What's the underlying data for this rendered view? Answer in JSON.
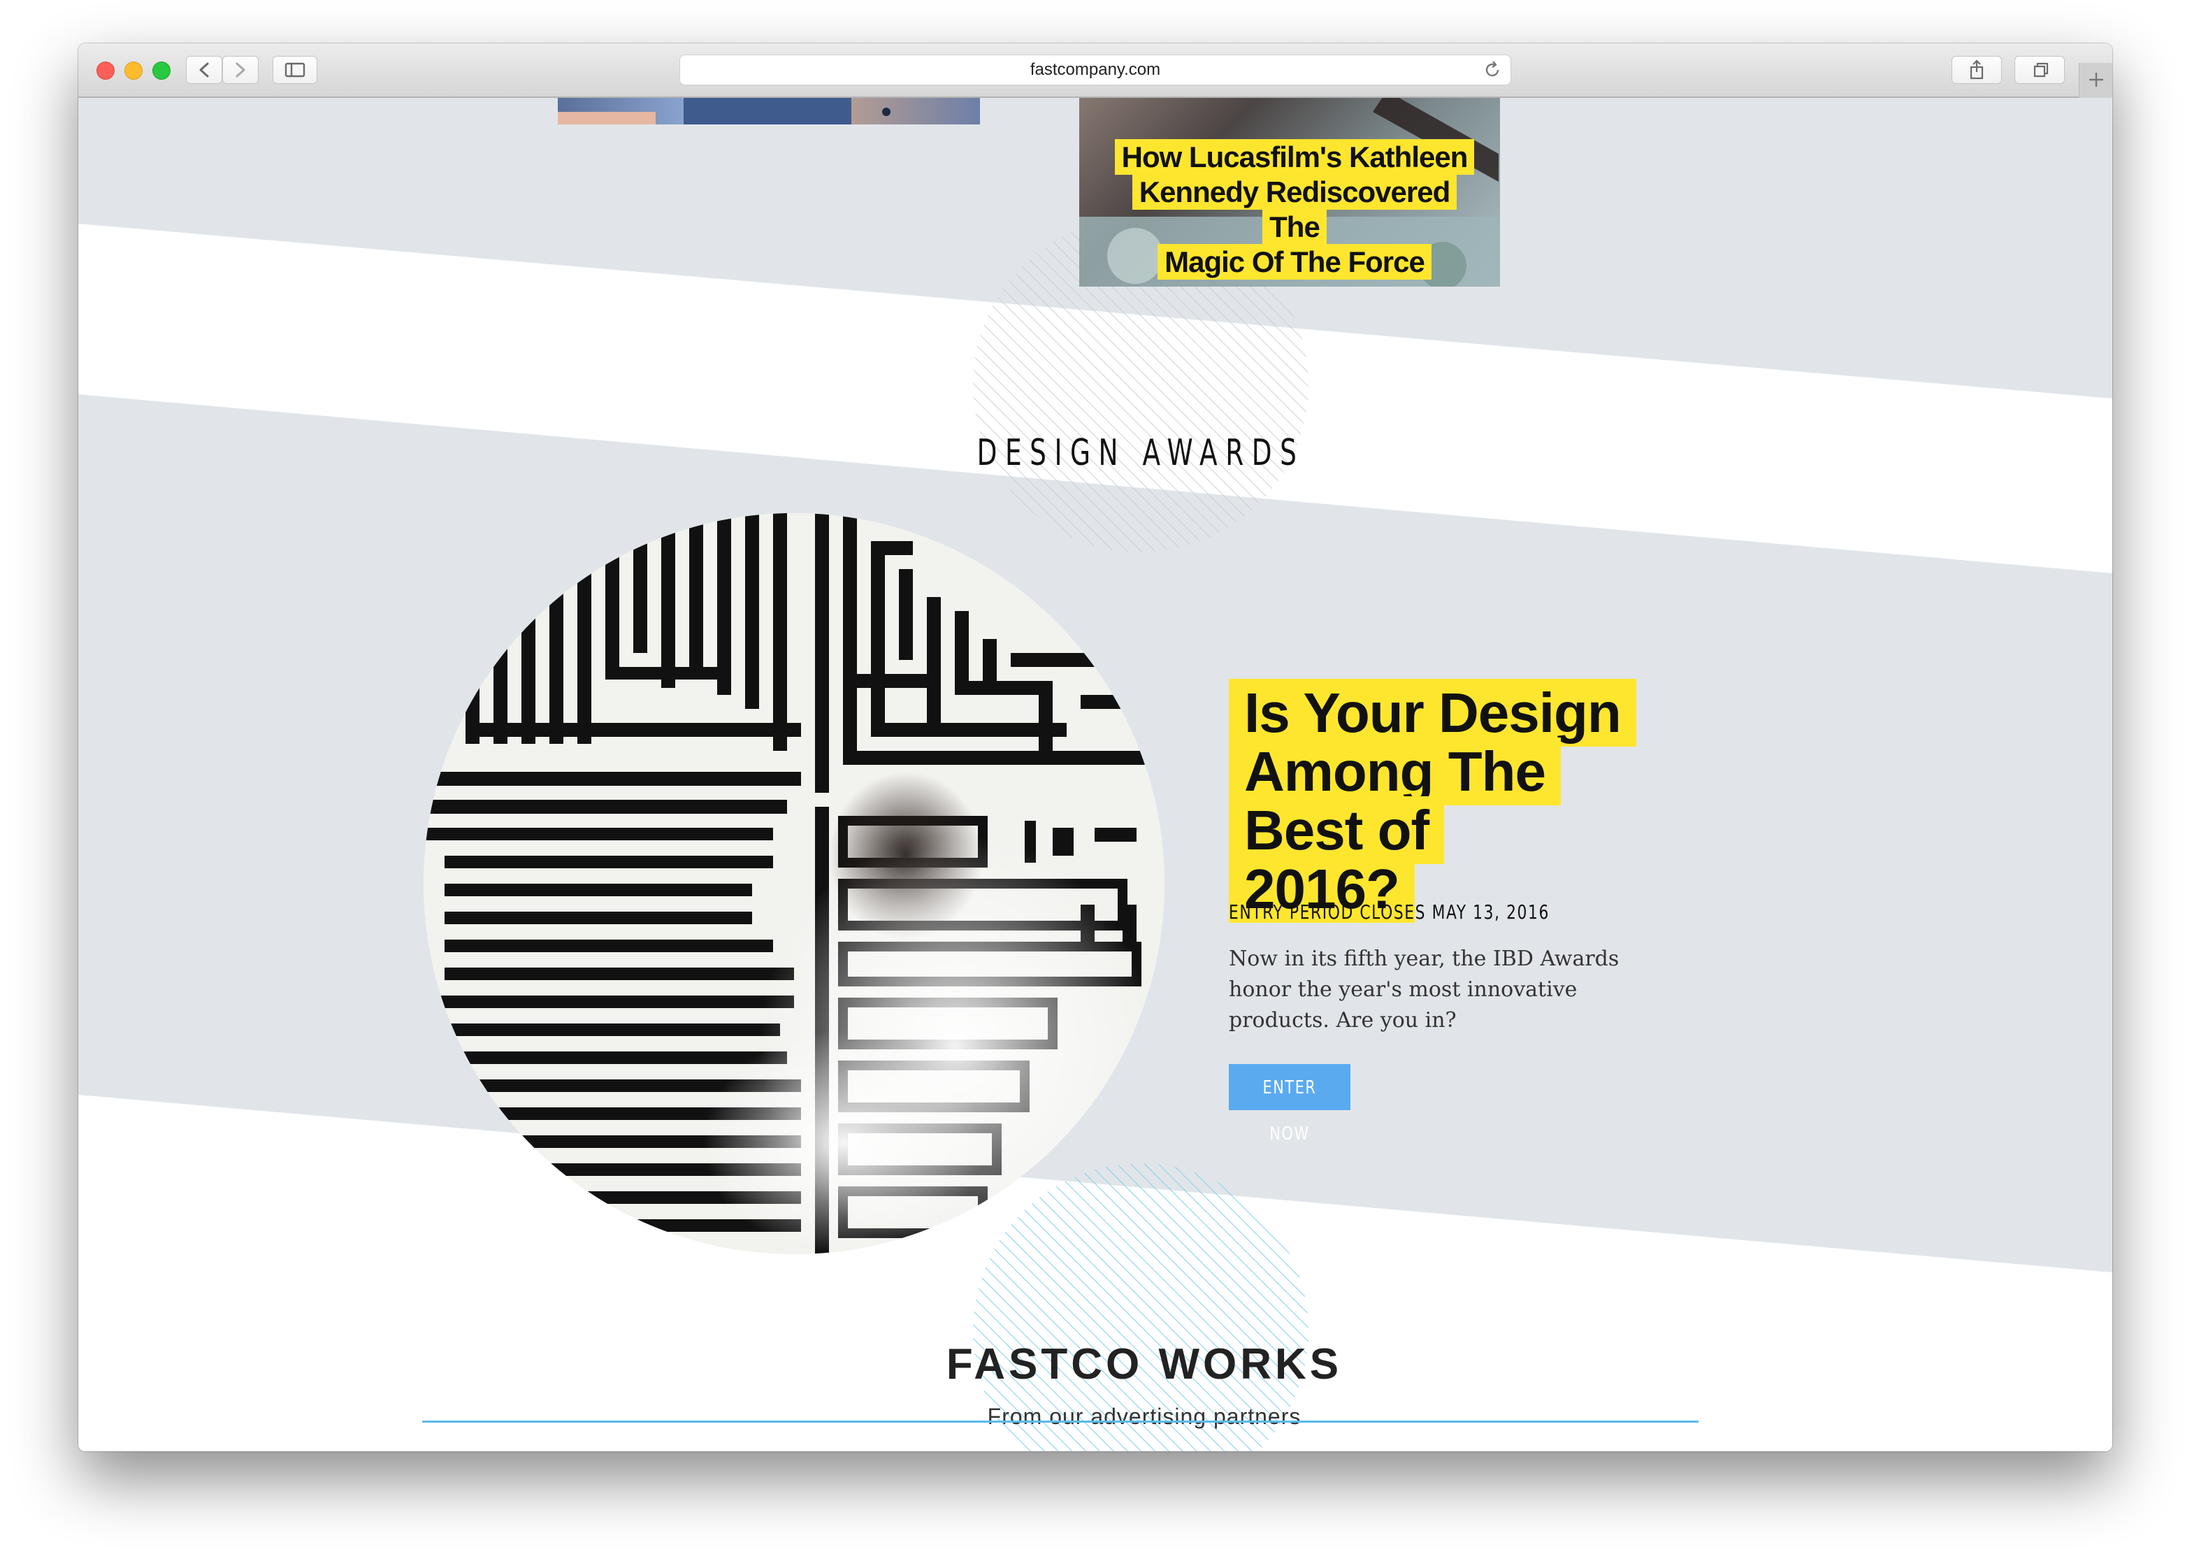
{
  "browser": {
    "url": "fastcompany.com"
  },
  "top_story": {
    "headline_lines": [
      "How Lucasfilm's Kathleen",
      "Kennedy Rediscovered The",
      "Magic Of The Force"
    ]
  },
  "design_awards": {
    "section_title": "DESIGN AWARDS",
    "headline_lines": [
      "Is Your Design",
      "Among The Best of",
      "2016?"
    ],
    "entry_period": "ENTRY PERIOD CLOSES MAY 13, 2016",
    "description": "Now in its fifth year, the IBD Awards honor the year's most innovative products. Are you in?",
    "cta_label": "ENTER NOW"
  },
  "fastco_works": {
    "title": "FASTCO WORKS",
    "subtitle": "From our advertising partners"
  },
  "colors": {
    "band_gray": "#e1e5e9",
    "highlight_yellow": "#ffe62e",
    "cta_blue": "#5aaaf0",
    "works_accent": "#5bbbe8"
  },
  "icons": [
    "close-dot-icon",
    "minimize-dot-icon",
    "zoom-dot-icon",
    "back-icon",
    "forward-icon",
    "sidebar-icon",
    "reload-icon",
    "share-icon",
    "tabs-icon",
    "new-tab-icon"
  ]
}
